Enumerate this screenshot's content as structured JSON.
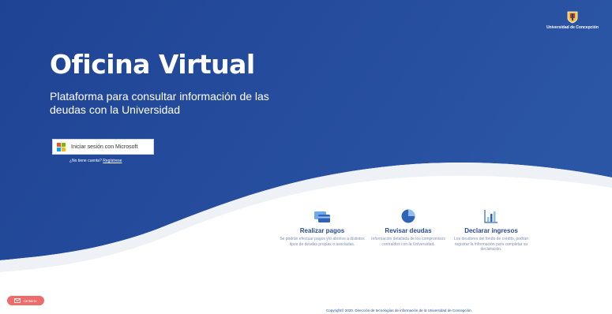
{
  "header": {
    "logo_text": "Universidad de Concepción",
    "logo_icon": "university-crest-icon"
  },
  "hero": {
    "title": "Oficina Virtual",
    "subtitle": "Plataforma para consultar información de las deudas con la Universidad"
  },
  "login": {
    "button_label": "Iniciar sesión con Microsoft",
    "button_icon": "microsoft-logo-icon",
    "no_account_text": "¿No tiene cuenta?",
    "register_link": "Regístrese"
  },
  "features": [
    {
      "icon": "payment-card-icon",
      "title": "Realizar pagos",
      "description": "Se podrán efectuar pagos y/o abonos a distintos tipos de deudas propias o asociadas."
    },
    {
      "icon": "pie-chart-icon",
      "title": "Revisar deudas",
      "description": "Información detallada de los compromisos contraídos con la Universidad."
    },
    {
      "icon": "bar-chart-icon",
      "title": "Declarar ingresos",
      "description": "Los deudores del fondo de crédito, podrán registrar la información para completar su declaración."
    }
  ],
  "contact": {
    "label": "contacto",
    "icon": "mail-icon"
  },
  "footer": {
    "copyright": "Copyright© 2020. Dirección de tecnologías de información de la Universidad de Concepción."
  },
  "colors": {
    "primary_blue": "#244a95",
    "accent_red": "#ee6b6b",
    "ms_red": "#f25022",
    "ms_green": "#7fba00",
    "ms_blue": "#00a4ef",
    "ms_yellow": "#ffb900"
  }
}
